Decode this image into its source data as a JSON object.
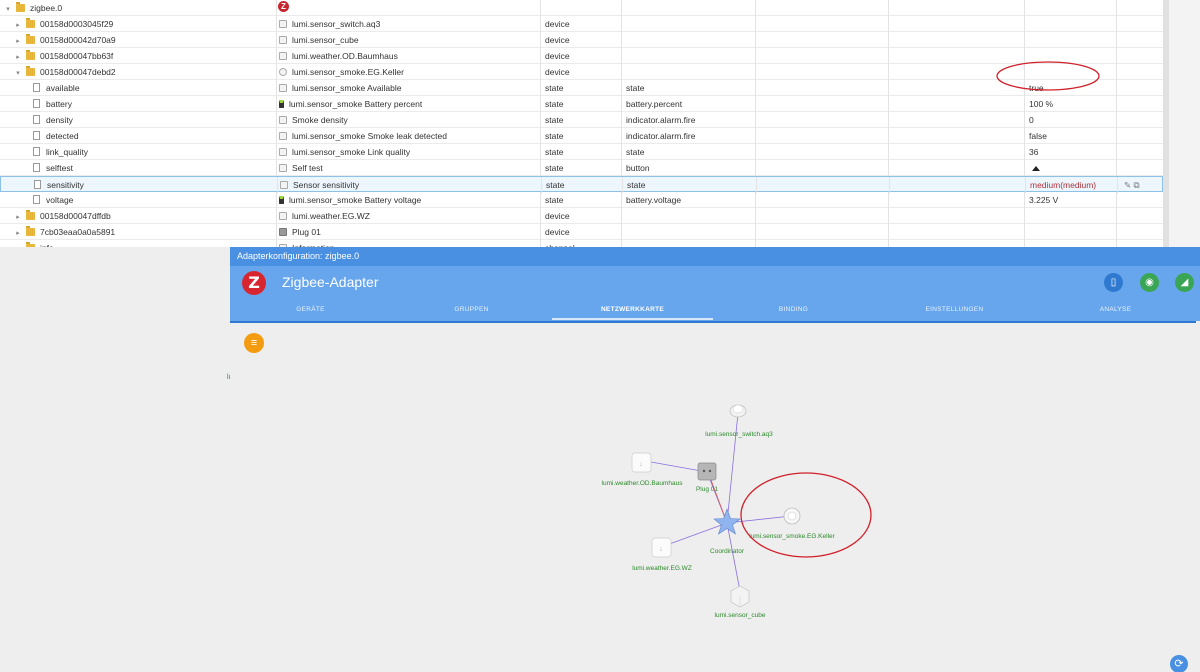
{
  "tree": {
    "rows": [
      {
        "id": "zigbee.0",
        "level": 0,
        "toggle": "▾",
        "icon": "folder",
        "name": "",
        "type": "",
        "role": "",
        "value": ""
      },
      {
        "id": "00158d0003045f29",
        "level": 1,
        "toggle": "▸",
        "icon": "folder",
        "name": "lumi.sensor_switch.aq3",
        "type": "device",
        "role": "",
        "value": ""
      },
      {
        "id": "00158d00042d70a9",
        "level": 1,
        "toggle": "▸",
        "icon": "folder",
        "name": "lumi.sensor_cube",
        "type": "device",
        "role": "",
        "value": ""
      },
      {
        "id": "00158d00047bb63f",
        "level": 1,
        "toggle": "▸",
        "icon": "folder",
        "name": "lumi.weather.OD.Baumhaus",
        "type": "device",
        "role": "",
        "value": ""
      },
      {
        "id": "00158d00047debd2",
        "level": 1,
        "toggle": "▾",
        "icon": "folder",
        "name": "lumi.sensor_smoke.EG.Keller",
        "type": "device",
        "role": "",
        "value": ""
      },
      {
        "id": "available",
        "level": 2,
        "toggle": "",
        "icon": "file",
        "name": "lumi.sensor_smoke Available",
        "type": "state",
        "role": "state",
        "value": "true"
      },
      {
        "id": "battery",
        "level": 2,
        "toggle": "",
        "icon": "file",
        "name": "lumi.sensor_smoke Battery percent",
        "type": "state",
        "role": "battery.percent",
        "value": "100 %"
      },
      {
        "id": "density",
        "level": 2,
        "toggle": "",
        "icon": "file",
        "name": "Smoke density",
        "type": "state",
        "role": "indicator.alarm.fire",
        "value": "0"
      },
      {
        "id": "detected",
        "level": 2,
        "toggle": "",
        "icon": "file",
        "name": "lumi.sensor_smoke Smoke leak detected",
        "type": "state",
        "role": "indicator.alarm.fire",
        "value": "false"
      },
      {
        "id": "link_quality",
        "level": 2,
        "toggle": "",
        "icon": "file",
        "name": "lumi.sensor_smoke Link quality",
        "type": "state",
        "role": "state",
        "value": "36"
      },
      {
        "id": "selftest",
        "level": 2,
        "toggle": "",
        "icon": "file",
        "name": "Self test",
        "type": "state",
        "role": "button",
        "value": ""
      },
      {
        "id": "sensitivity",
        "level": 2,
        "toggle": "",
        "icon": "file",
        "name": "Sensor sensitivity",
        "type": "state",
        "role": "state",
        "value": "medium(medium)"
      },
      {
        "id": "voltage",
        "level": 2,
        "toggle": "",
        "icon": "file",
        "name": "lumi.sensor_smoke Battery voltage",
        "type": "state",
        "role": "battery.voltage",
        "value": "3.225 V"
      },
      {
        "id": "00158d00047dffdb",
        "level": 1,
        "toggle": "▸",
        "icon": "folder",
        "name": "lumi.weather.EG.WZ",
        "type": "device",
        "role": "",
        "value": ""
      },
      {
        "id": "7cb03eaa0a0a5891",
        "level": 1,
        "toggle": "▸",
        "icon": "folder",
        "name": "Plug 01",
        "type": "device",
        "role": "",
        "value": ""
      },
      {
        "id": "info",
        "level": 1,
        "toggle": "▸",
        "icon": "folder",
        "name": "Information",
        "type": "channel",
        "role": "",
        "value": ""
      }
    ],
    "selected_row": "sensitivity",
    "action_icons": [
      "pencil-icon",
      "copy-icon"
    ]
  },
  "config": {
    "window_title": "Adapterkonfiguration: zigbee.0",
    "logo_letter": "Z",
    "app_title": "Zigbee-Adapter",
    "tabs": [
      "GERÄTE",
      "GRUPPEN",
      "NETZWERKKARTE",
      "BINDING",
      "EINSTELLUNGEN",
      "ANALYSE"
    ],
    "active_tab": "NETZWERKKARTE",
    "menu_icon": "≡",
    "tiny_mark": "lı"
  },
  "netmap": {
    "nodes": [
      {
        "key": "switch",
        "label": "lumi.sensor_switch.aq3"
      },
      {
        "key": "baumhaus",
        "label": "lumi.weather.OD.Baumhaus"
      },
      {
        "key": "plug",
        "label": "Plug 01"
      },
      {
        "key": "smoke",
        "label": "lumi.sensor_smoke.EG.Keller"
      },
      {
        "key": "coordinator",
        "label": "Coordinator"
      },
      {
        "key": "wz",
        "label": "lumi.weather.EG.WZ"
      },
      {
        "key": "cube",
        "label": "lumi.sensor_cube"
      }
    ]
  },
  "colors": {
    "header_blue": "#67a6ec",
    "title_blue": "#4a90e2",
    "label_green": "#2b8a2b",
    "annotation_red": "#d0202a",
    "link_purple": "#8a6fe0",
    "link_red": "#e05050"
  }
}
